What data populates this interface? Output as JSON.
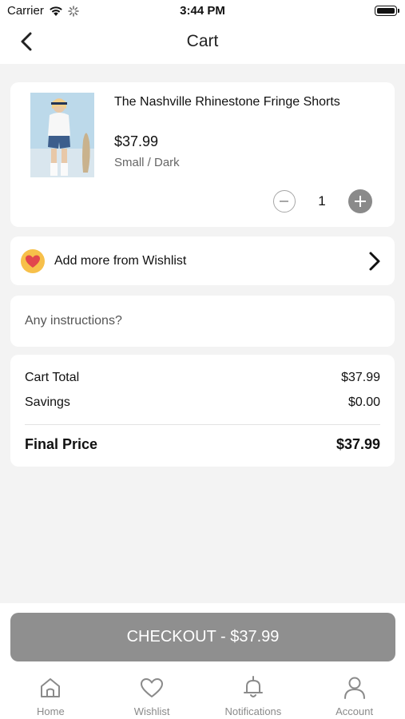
{
  "status_bar": {
    "carrier": "Carrier",
    "time": "3:44 PM",
    "icons": [
      "wifi-icon",
      "activity-spinner-icon",
      "battery-icon"
    ]
  },
  "nav": {
    "title": "Cart",
    "back_icon": "chevron-left-icon"
  },
  "cart_item": {
    "name": "The Nashville Rhinestone Fringe Shorts",
    "price": "$37.99",
    "variant": "Small / Dark",
    "quantity": "1",
    "minus_icon": "minus-circle-icon",
    "plus_icon": "plus-circle-icon"
  },
  "wishlist": {
    "label": "Add more from Wishlist",
    "icon": "heart-icon",
    "chevron_icon": "chevron-right-icon"
  },
  "instructions": {
    "placeholder": "Any instructions?",
    "value": ""
  },
  "summary": {
    "cart_total_label": "Cart Total",
    "cart_total_value": "$37.99",
    "savings_label": "Savings",
    "savings_value": "$0.00",
    "final_label": "Final Price",
    "final_value": "$37.99"
  },
  "checkout": {
    "label": "CHECKOUT - $37.99"
  },
  "tabs": [
    {
      "label": "Home",
      "icon": "home-icon"
    },
    {
      "label": "Wishlist",
      "icon": "heart-outline-icon"
    },
    {
      "label": "Notifications",
      "icon": "bell-icon"
    },
    {
      "label": "Account",
      "icon": "user-icon"
    }
  ],
  "colors": {
    "background": "#f3f3f3",
    "card": "#ffffff",
    "checkout_button": "#8f8f8f",
    "wishlist_badge": "#f7c04a",
    "heart": "#e2474d",
    "tab_inactive": "#8a8a8a"
  }
}
